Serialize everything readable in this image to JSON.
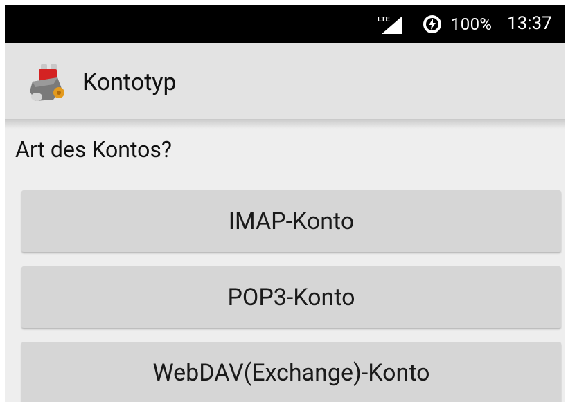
{
  "status_bar": {
    "network_label": "LTE",
    "battery": "100%",
    "time": "13:37"
  },
  "action_bar": {
    "title": "Kontotyp"
  },
  "content": {
    "prompt": "Art des Kontos?",
    "buttons": [
      {
        "label": "IMAP-Konto"
      },
      {
        "label": "POP3-Konto"
      },
      {
        "label": "WebDAV(Exchange)-Konto"
      }
    ]
  },
  "icons": {
    "network": "lte-signal-icon",
    "battery_saver": "battery-saver-icon",
    "app": "k9-mail-app-icon"
  },
  "colors": {
    "status_bar_bg": "#000000",
    "action_bar_bg": "#e3e3e3",
    "content_bg": "#eeeeee",
    "button_bg": "#d6d6d6"
  }
}
